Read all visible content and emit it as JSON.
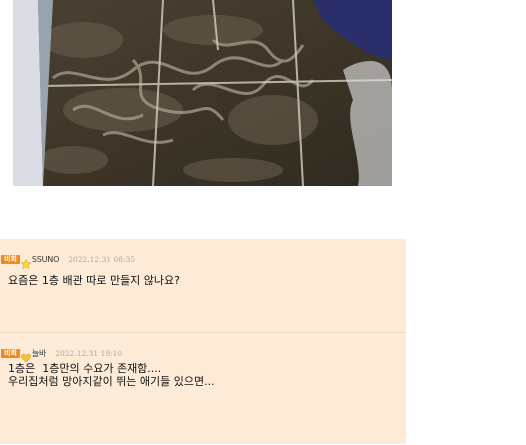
{
  "photo": {
    "alt": ""
  },
  "comments": [
    {
      "badge": "비회",
      "nickname": "SSUNO",
      "date": "2022.12.31 08:35",
      "text": "요즘은 1층 배관 따로 만들지 않나요?",
      "rank_icon": "star-icon"
    },
    {
      "badge": "비회",
      "nickname": "늘바",
      "date": "2022.12.31 19:10",
      "text": "1층은  1층만의 수요가 존재함....\n우리집처럼 망아지같이 뛰는 애기들 있으면...",
      "rank_icon": "heart-badge-icon"
    }
  ],
  "colors": {
    "comment_bg": "#fdebd8",
    "badge_bg": "#f0891e"
  }
}
